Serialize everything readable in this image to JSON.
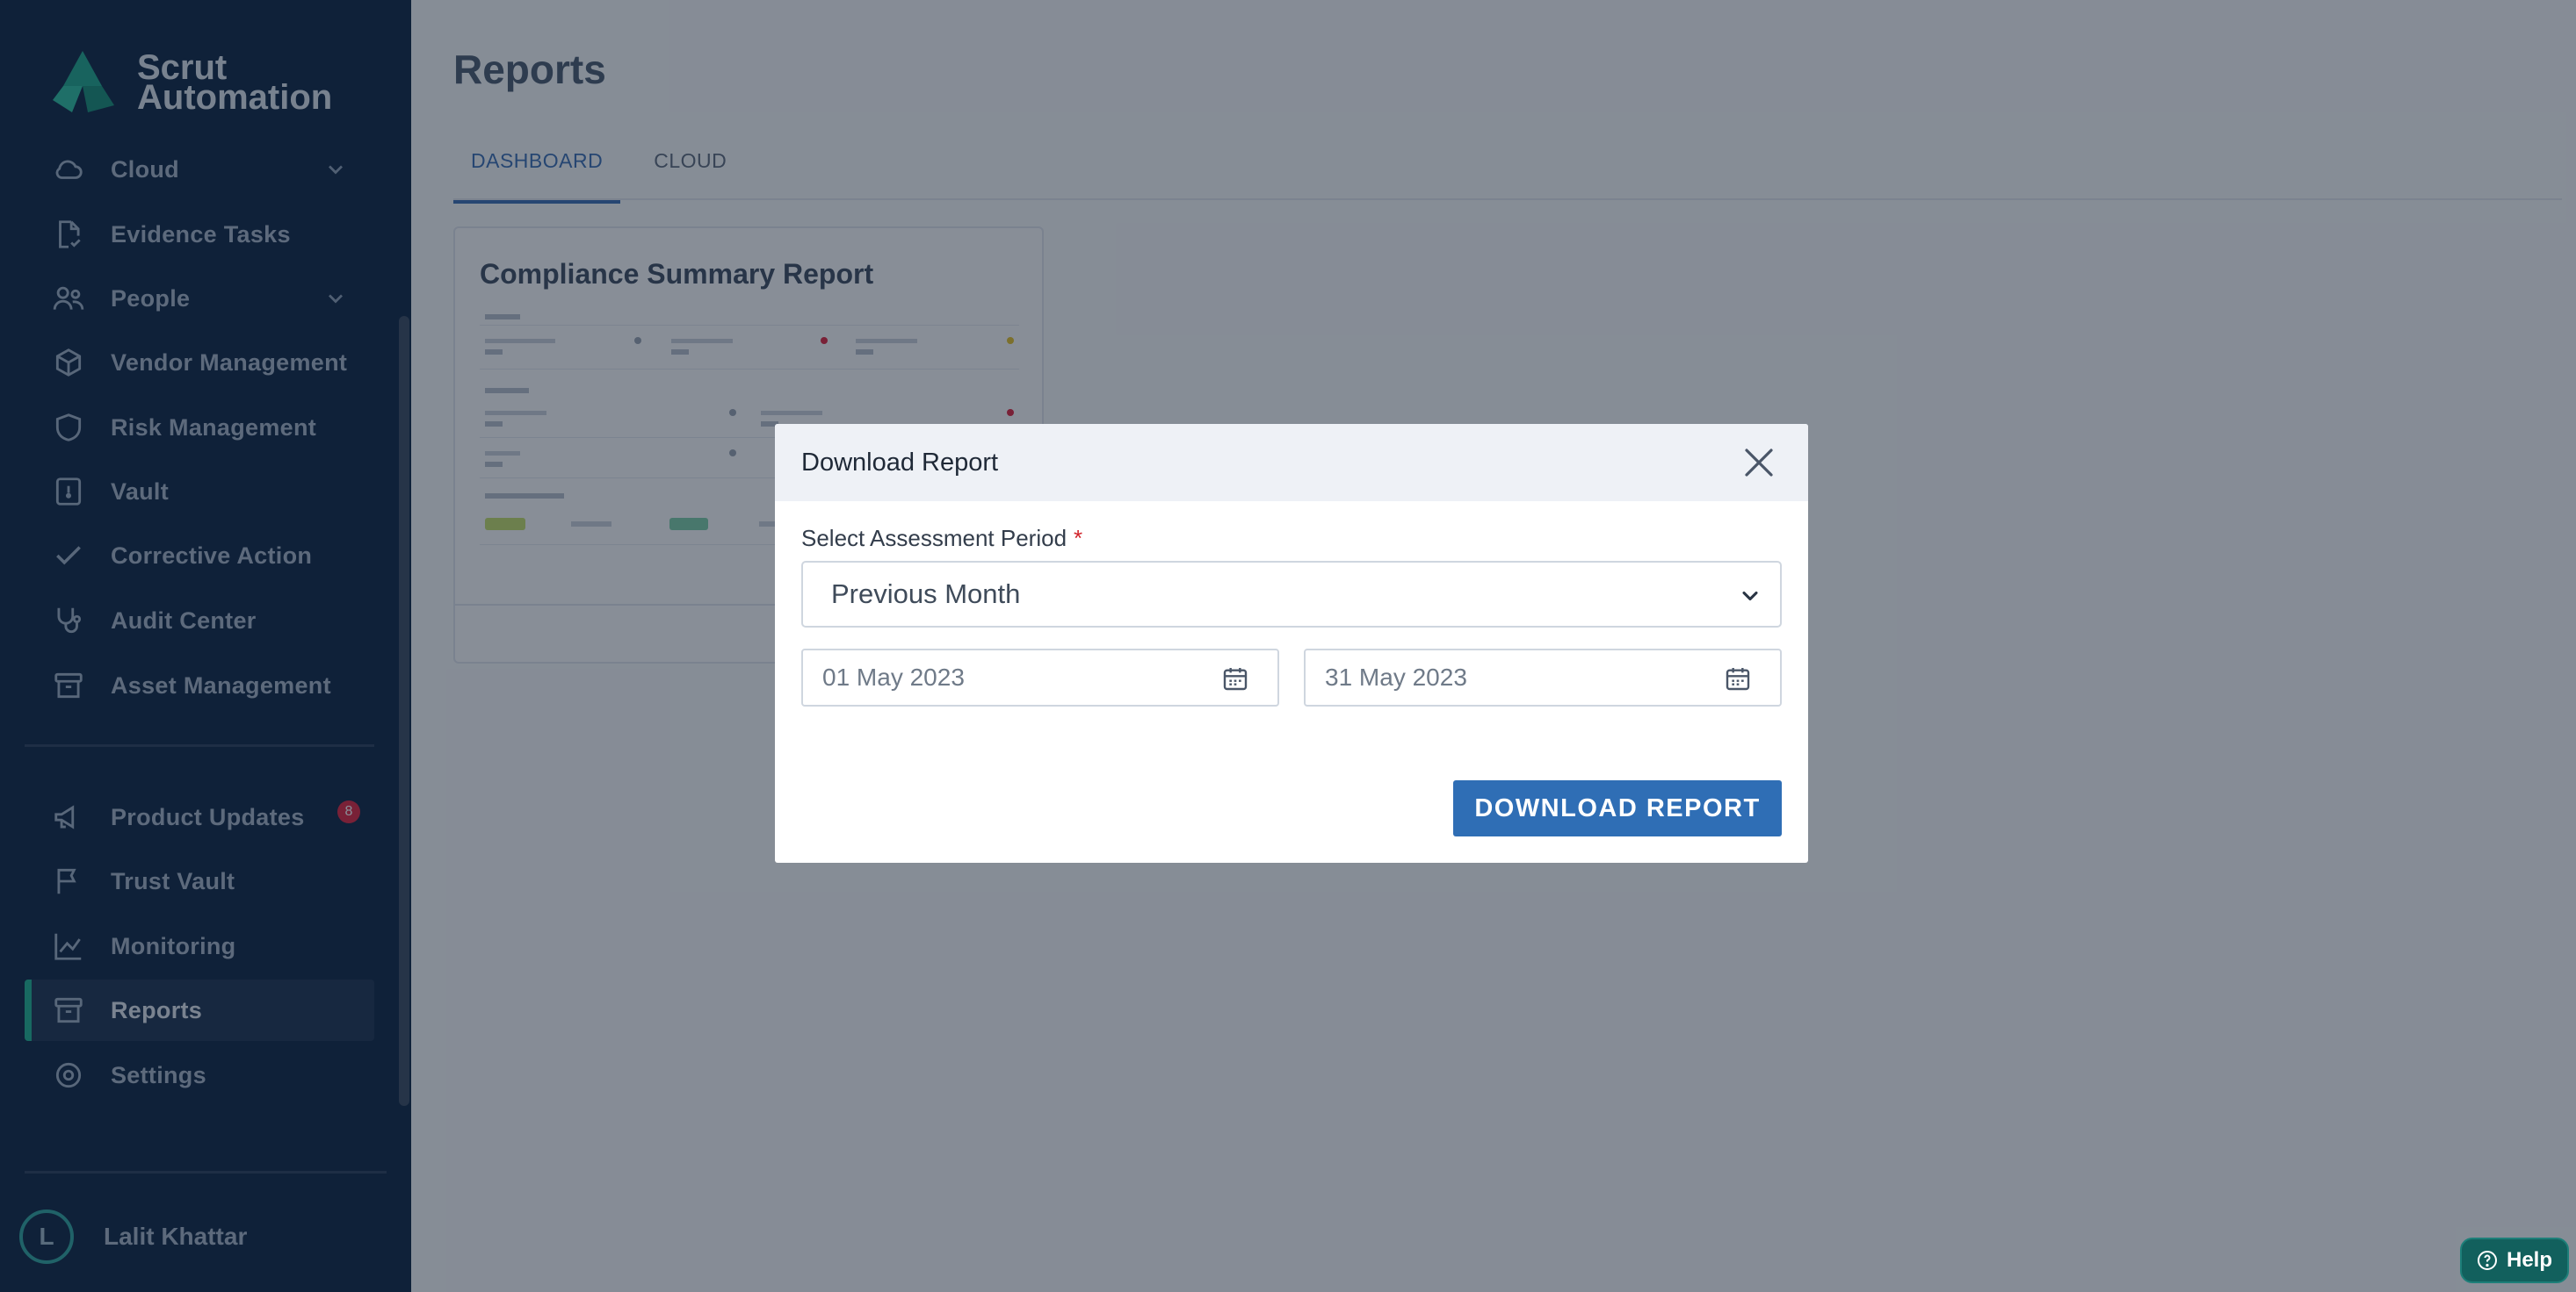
{
  "sidebar": {
    "brand_line1": "Scrut",
    "brand_line2": "Automation",
    "items": [
      {
        "label": "Cloud",
        "icon": "cloud-icon",
        "expandable": true
      },
      {
        "label": "Evidence Tasks",
        "icon": "document-check-icon"
      },
      {
        "label": "People",
        "icon": "people-icon",
        "expandable": true
      },
      {
        "label": "Vendor Management",
        "icon": "cube-icon"
      },
      {
        "label": "Risk Management",
        "icon": "shield-icon"
      },
      {
        "label": "Vault",
        "icon": "vault-icon"
      },
      {
        "label": "Corrective Action",
        "icon": "check-icon"
      },
      {
        "label": "Audit Center",
        "icon": "stethoscope-icon"
      },
      {
        "label": "Asset Management",
        "icon": "archive-box-icon"
      }
    ],
    "secondary_items": [
      {
        "label": "Product Updates",
        "icon": "megaphone-icon",
        "badge": "8"
      },
      {
        "label": "Trust Vault",
        "icon": "flag-icon"
      },
      {
        "label": "Monitoring",
        "icon": "line-chart-icon"
      },
      {
        "label": "Reports",
        "icon": "archive-box-icon",
        "active": true
      },
      {
        "label": "Settings",
        "icon": "gear-icon"
      }
    ],
    "user": {
      "initial": "L",
      "name": "Lalit Khattar"
    }
  },
  "main": {
    "title": "Reports",
    "tabs": [
      {
        "label": "DASHBOARD",
        "active": true
      },
      {
        "label": "CLOUD",
        "active": false
      }
    ],
    "card": {
      "title": "Compliance Summary Report"
    }
  },
  "modal": {
    "title": "Download Report",
    "field_label": "Select Assessment Period",
    "required_mark": "*",
    "selected_period": "Previous Month",
    "start_date": "01 May 2023",
    "end_date": "31 May 2023",
    "download_label": "DOWNLOAD REPORT"
  },
  "help": {
    "label": "Help"
  },
  "colors": {
    "sidebar_bg": "#0c2442",
    "accent_active": "#1fb592",
    "primary_button": "#2f6eb5",
    "required": "#d1232a",
    "help_bg": "#12605d"
  }
}
